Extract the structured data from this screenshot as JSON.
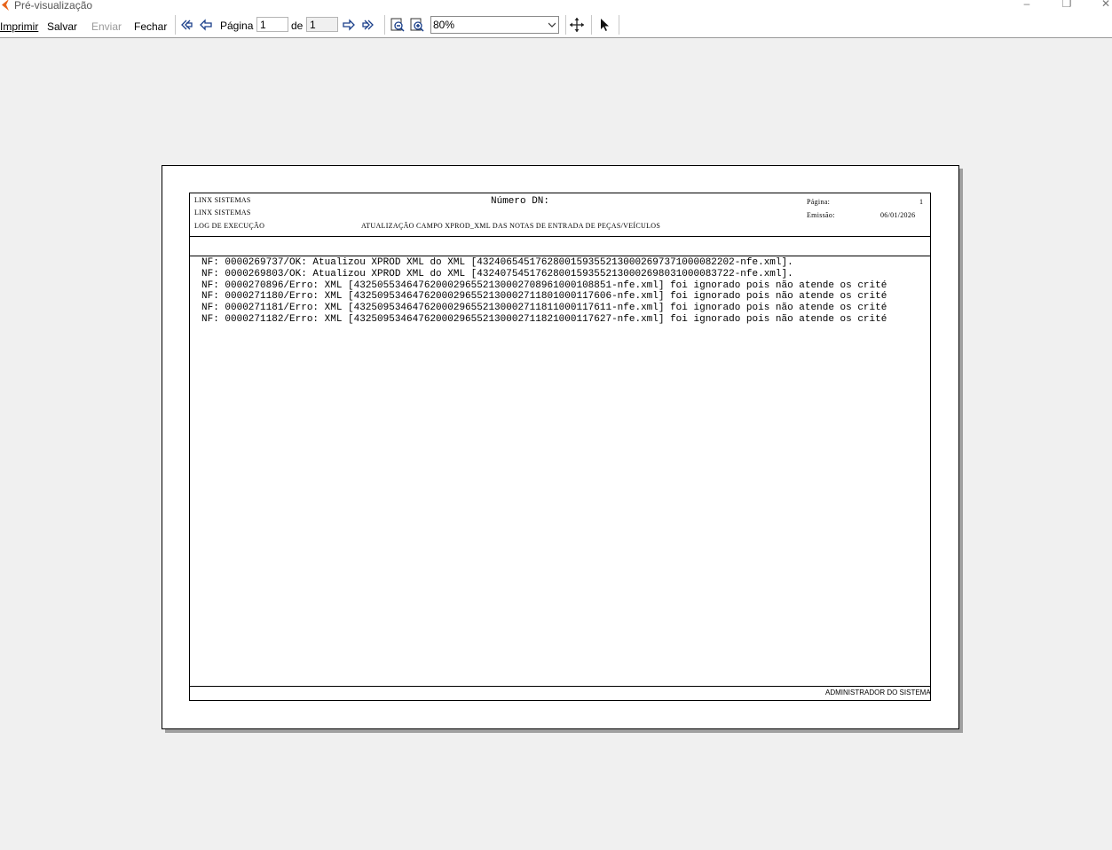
{
  "window": {
    "title": "Pré-visualização",
    "minimize_glyph": "–",
    "restore_glyph": "❐",
    "close_glyph": "✕"
  },
  "menu": {
    "print": "Imprimir",
    "save": "Salvar",
    "send": "Enviar",
    "close": "Fechar"
  },
  "navigation": {
    "page_label": "Página",
    "current_page": "1",
    "of_label": "de",
    "total_pages": "1"
  },
  "zoom": {
    "value": "80%"
  },
  "icons": {
    "first_page": "double-arrow-left-icon",
    "prev_page": "arrow-left-icon",
    "next_page": "arrow-right-icon",
    "last_page": "double-arrow-right-icon",
    "zoom_out": "zoom-out-icon",
    "zoom_in": "zoom-in-icon",
    "pan": "move-icon",
    "select": "pointer-icon"
  },
  "report": {
    "company_1": "LINX SISTEMAS",
    "company_2": "LINX SISTEMAS",
    "section": "LOG DE EXECUÇÃO",
    "title": "Número DN:",
    "subtitle": "ATUALIZAÇÃO CAMPO XPROD_XML DAS NOTAS DE ENTRADA DE PEÇAS/VEÍCULOS",
    "page_label": "Página:",
    "page_value": "1",
    "emission_label": "Emissão:",
    "emission_value": "06/01/2026",
    "lines": [
      "NF: 0000269737/OK: Atualizou XPROD XML do XML [43240654517628001593552130002697371000082202-nfe.xml].",
      "NF: 0000269803/OK: Atualizou XPROD XML do XML [43240754517628001593552130002698031000083722-nfe.xml].",
      "NF: 0000270896/Erro: XML [43250553464762000296552130002708961000108851-nfe.xml] foi ignorado pois não atende os crité",
      "NF: 0000271180/Erro: XML [43250953464762000296552130002711801000117606-nfe.xml] foi ignorado pois não atende os crité",
      "NF: 0000271181/Erro: XML [43250953464762000296552130002711811000117611-nfe.xml] foi ignorado pois não atende os crité",
      "NF: 0000271182/Erro: XML [43250953464762000296552130002711821000117627-nfe.xml] foi ignorado pois não atende os crité"
    ],
    "footer": "ADMINISTRADOR DO SISTEMA"
  }
}
